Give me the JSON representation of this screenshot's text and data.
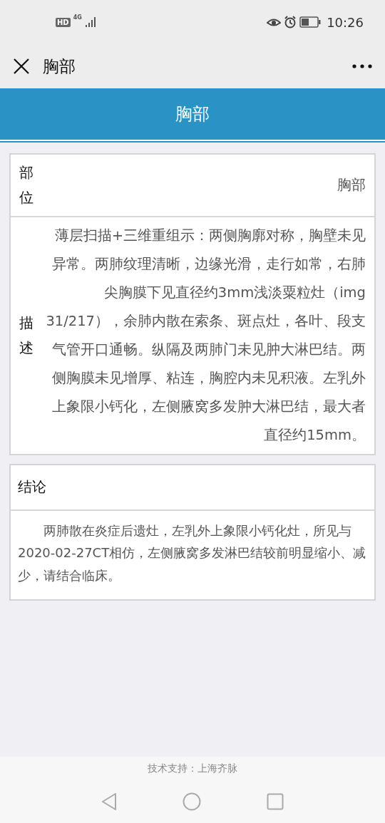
{
  "status_bar": {
    "network_badge": "HD",
    "network_type": "4G",
    "time": "10:26"
  },
  "nav_bar": {
    "title": "胸部"
  },
  "header": {
    "title": "胸部"
  },
  "report_table": {
    "rows": [
      {
        "label": "部位",
        "value": "胸部",
        "kind": "short"
      },
      {
        "label": "描述",
        "value": "薄层扫描+三维重组示：两侧胸廓对称，胸壁未见异常。两肺纹理清晰，边缘光滑，走行如常，右肺尖胸膜下见直径约3mm浅淡粟粒灶（img 31/217），余肺内散在索条、斑点灶，各叶、段支气管开口通畅。纵隔及两肺门未见肿大淋巴结。两侧胸膜未见增厚、粘连，胸腔内未见积液。左乳外上象限小钙化，左侧腋窝多发肿大淋巴结，最大者直径约15mm。",
        "kind": "long"
      }
    ]
  },
  "conclusion": {
    "title": "结论",
    "text": "两肺散在炎症后遗灶，左乳外上象限小钙化灶，所见与2020-02-27CT相仿，左侧腋窝多发淋巴结较前明显缩小、减少，请结合临床。"
  },
  "footer": {
    "text": "技术支持：上海齐脉"
  }
}
